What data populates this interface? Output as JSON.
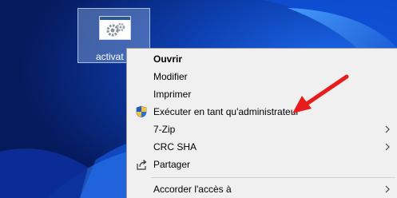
{
  "desktop": {
    "file_icon": {
      "label": "activat",
      "icon": "settings-file-icon"
    }
  },
  "context_menu": {
    "items": [
      {
        "label": "Ouvrir",
        "bold": true
      },
      {
        "label": "Modifier"
      },
      {
        "label": "Imprimer"
      },
      {
        "label": "Exécuter en tant qu'administrateur",
        "icon": "uac-shield-icon"
      },
      {
        "label": "7-Zip",
        "submenu": true
      },
      {
        "label": "CRC SHA",
        "submenu": true
      },
      {
        "label": "Partager",
        "icon": "share-icon"
      },
      {
        "label": "Accorder l'accès à",
        "submenu": true
      }
    ]
  },
  "annotation": {
    "arrow_color": "#e81c1c"
  },
  "colors": {
    "desktop_background": "#0a2a8a",
    "menu_background": "#f0f0f0"
  }
}
